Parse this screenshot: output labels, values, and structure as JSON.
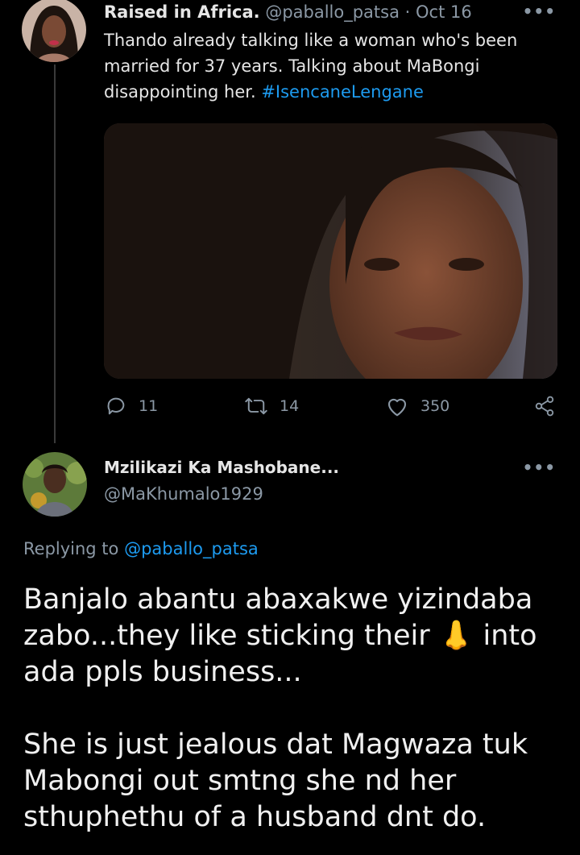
{
  "tweet1": {
    "display_name": "Raised in Africa.",
    "handle": "@paballo_patsa",
    "separator": " · ",
    "date": "Oct 16",
    "more_icon": "more-dots-icon",
    "text": "Thando already talking like a woman who's been married for 37 years. Talking about MaBongi disappointing her.",
    "hashtag": "#IsencaneLengane",
    "actions": {
      "replies": "11",
      "retweets": "14",
      "likes": "350"
    }
  },
  "reply": {
    "display_name": "Mzilikazi Ka Mashobane...",
    "handle": "@MaKhumalo1929",
    "replying_prefix": "Replying to",
    "replying_to": "@paballo_patsa",
    "paragraph1_a": "Banjalo abantu abaxakwe yizindaba zabo...they like sticking their",
    "emoji": "👃",
    "paragraph1_b": "into ada ppls business...",
    "paragraph2": "She is just jealous dat Magwaza tuk Mabongi out smtng she nd her sthuphethu of a husband dnt do."
  },
  "colors": {
    "background": "#000000",
    "link": "#1d9bf0",
    "muted": "#8b98a5",
    "text": "#e6e6e6"
  }
}
